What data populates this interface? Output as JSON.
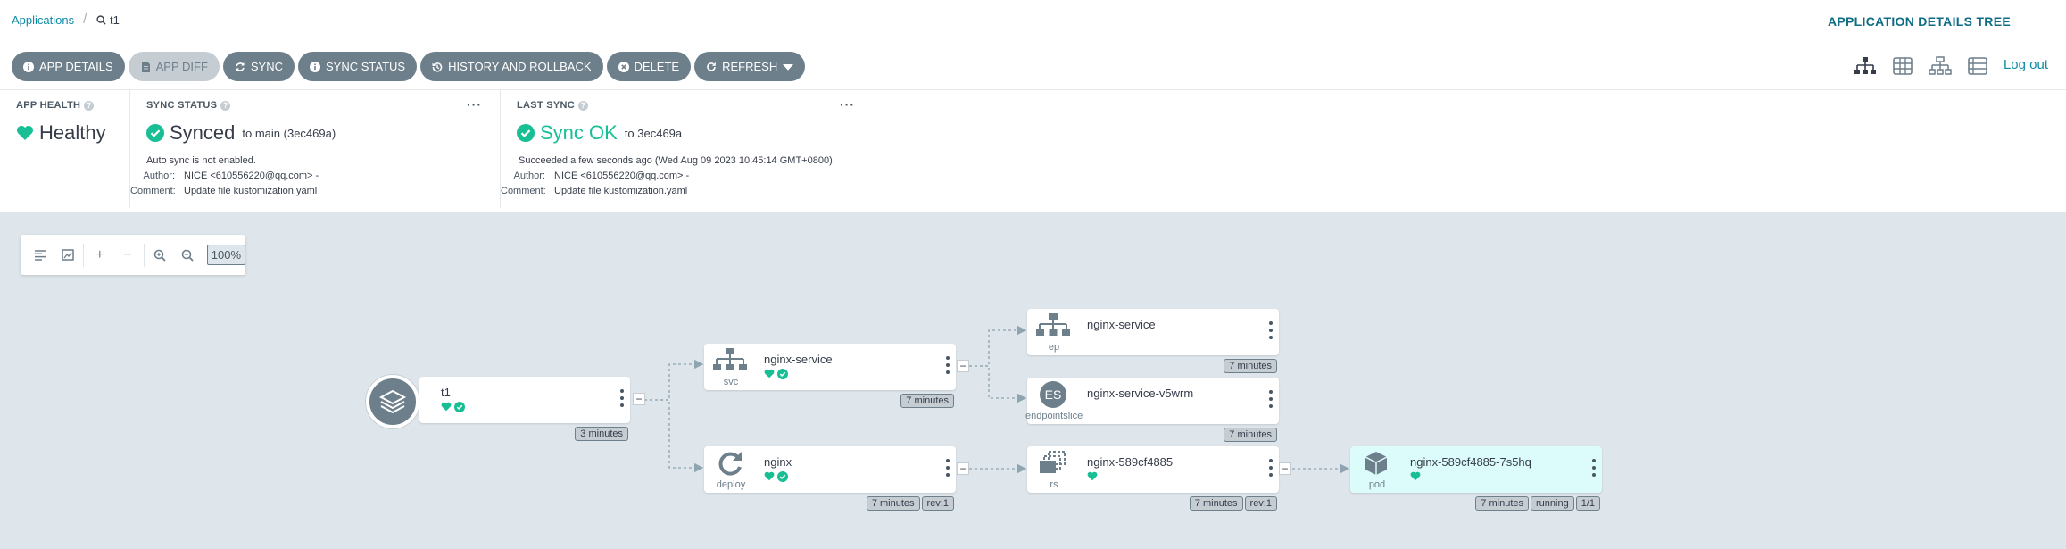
{
  "breadcrumb": {
    "root": "Applications",
    "search_value": "t1"
  },
  "page_title": "APPLICATION DETAILS TREE",
  "toolbar": [
    {
      "label": "APP DETAILS",
      "icon": "info-icon"
    },
    {
      "label": "APP DIFF",
      "icon": "file-icon"
    },
    {
      "label": "SYNC",
      "icon": "sync-icon"
    },
    {
      "label": "SYNC STATUS",
      "icon": "info-icon"
    },
    {
      "label": "HISTORY AND ROLLBACK",
      "icon": "history-icon"
    },
    {
      "label": "DELETE",
      "icon": "delete-icon"
    },
    {
      "label": "REFRESH",
      "icon": "refresh-icon"
    }
  ],
  "logout_label": "Log out",
  "app_health": {
    "title": "APP HEALTH",
    "status": "Healthy",
    "color": "#18be94"
  },
  "sync_status": {
    "title": "SYNC STATUS",
    "status": "Synced",
    "target": "to main (3ec469a)",
    "auto_sync": "Auto sync is not enabled.",
    "author_label": "Author:",
    "author": "NICE <610556220@qq.com> -",
    "comment_label": "Comment:",
    "comment": "Update file kustomization.yaml"
  },
  "last_sync": {
    "title": "LAST SYNC",
    "status": "Sync OK",
    "target": "to 3ec469a",
    "succeeded": "Succeeded a few seconds ago (Wed Aug 09 2023 10:45:14 GMT+0800)",
    "author_label": "Author:",
    "author": "NICE <610556220@qq.com> -",
    "comment_label": "Comment:",
    "comment": "Update file kustomization.yaml"
  },
  "zoom": {
    "percent": "100%"
  },
  "nodes": {
    "app": {
      "name": "t1",
      "age": "3 minutes"
    },
    "svc": {
      "name": "nginx-service",
      "kind": "svc",
      "age": "7 minutes"
    },
    "ep": {
      "name": "nginx-service",
      "kind": "ep",
      "age": "7 minutes"
    },
    "eps": {
      "name": "nginx-service-v5wrm",
      "kind": "endpointslice",
      "icon_text": "ES",
      "age": "7 minutes"
    },
    "deploy": {
      "name": "nginx",
      "kind": "deploy",
      "age": "7 minutes",
      "rev": "rev:1"
    },
    "rs": {
      "name": "nginx-589cf4885",
      "kind": "rs",
      "age": "7 minutes",
      "rev": "rev:1"
    },
    "pod": {
      "name": "nginx-589cf4885-7s5hq",
      "kind": "pod",
      "age": "7 minutes",
      "state": "running",
      "ready": "1/1"
    }
  },
  "colors": {
    "accent": "#0d8ba6",
    "healthy": "#18be94",
    "button": "#6d7f8b",
    "canvas": "#dee6eb"
  }
}
